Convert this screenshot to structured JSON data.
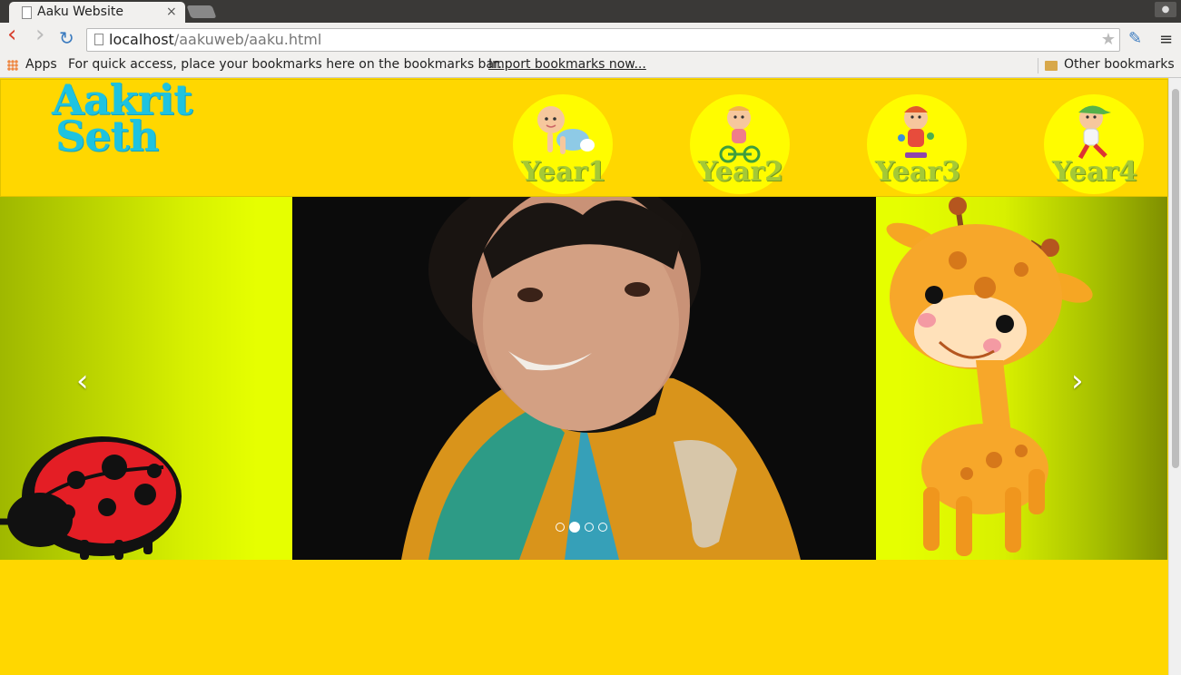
{
  "browser": {
    "tab_title": "Aaku Website",
    "tab_close": "×",
    "url_host": "localhost",
    "url_path": "/aakuweb/aaku.html",
    "back": "‹",
    "forward": "›",
    "reload": "↻",
    "star": "★",
    "menu": "≡",
    "bookmarks": {
      "apps": "Apps",
      "hint": "For quick access, place your bookmarks here on the bookmarks bar.",
      "import": "Import bookmarks now...",
      "other": "Other bookmarks"
    }
  },
  "header": {
    "logo_line1": "Aakrit",
    "logo_line2": "Seth",
    "years": [
      "Year1",
      "Year2",
      "Year3",
      "Year4"
    ]
  },
  "carousel": {
    "prev": "‹",
    "next": "›",
    "slide_count": 4,
    "active_slide": 2
  },
  "colors": {
    "page_bg": "#ffd700",
    "logo": "#1ec3e0",
    "year_label": "#a5c936",
    "year_circle": "#fffc00"
  }
}
